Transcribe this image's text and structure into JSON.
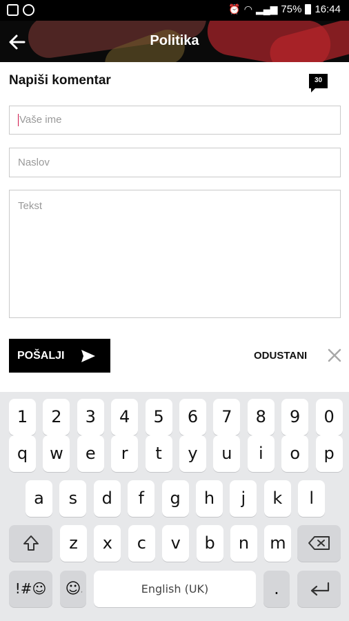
{
  "status_bar": {
    "battery": "75%",
    "time": "16:44"
  },
  "header": {
    "title": "Politika"
  },
  "form": {
    "title": "Napiši komentar",
    "comment_count": "30",
    "name_placeholder": "Vaše ime",
    "subject_placeholder": "Naslov",
    "text_placeholder": "Tekst",
    "send_label": "POŠALJI",
    "cancel_label": "ODUSTANI"
  },
  "keyboard": {
    "row_numbers": [
      "1",
      "2",
      "3",
      "4",
      "5",
      "6",
      "7",
      "8",
      "9",
      "0"
    ],
    "row_top": [
      "q",
      "w",
      "e",
      "r",
      "t",
      "y",
      "u",
      "i",
      "o",
      "p"
    ],
    "row_middle": [
      "a",
      "s",
      "d",
      "f",
      "g",
      "h",
      "j",
      "k",
      "l"
    ],
    "row_bottom": [
      "z",
      "x",
      "c",
      "v",
      "b",
      "n",
      "m"
    ],
    "symbols_label": "!#☺",
    "space_label": "English (UK)",
    "period_label": "."
  }
}
